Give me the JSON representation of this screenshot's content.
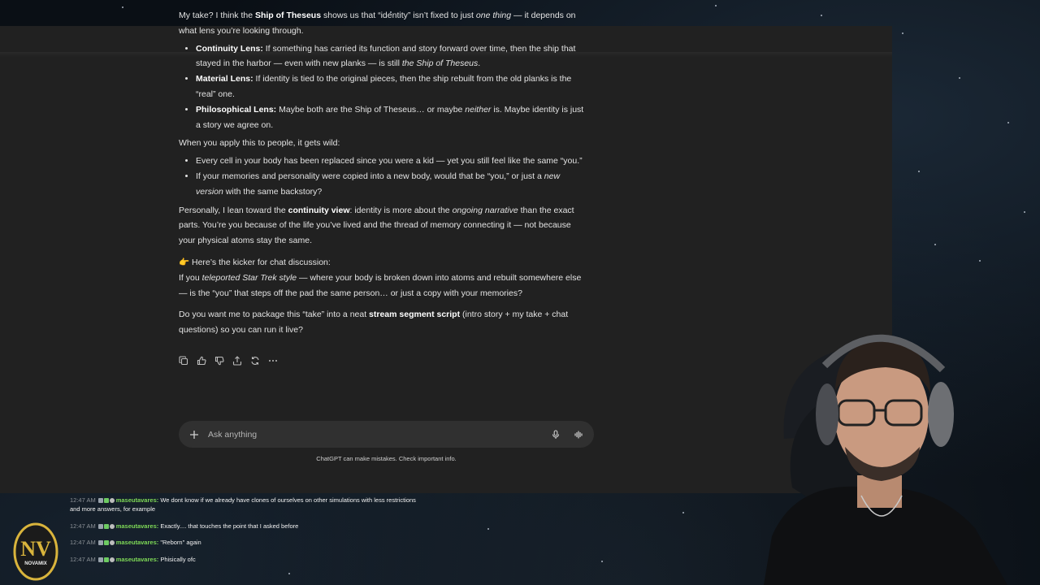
{
  "response": {
    "intro_1": "My take? I think the ",
    "intro_bold": "Ship of Theseus",
    "intro_2": " shows us that “identity” isn’t fixed to just ",
    "intro_italic": "one thing",
    "intro_3": " — it depends on what lens you’re looking through.",
    "lenses": [
      {
        "title": "Continuity Lens:",
        "text": " If something has carried its function and story forward over time, then the ship that stayed in the harbor — even with new planks — is still ",
        "italic": "the Ship of Theseus",
        "tail": "."
      },
      {
        "title": "Material Lens:",
        "text": " If identity is tied to the original pieces, then the ship rebuilt from the old planks is the “real” one.",
        "italic": "",
        "tail": ""
      },
      {
        "title": "Philosophical Lens:",
        "text": " Maybe both are the Ship of Theseus… or maybe ",
        "italic": "neither",
        "tail": " is. Maybe identity is just a story we agree on."
      }
    ],
    "people_intro": "When you apply this to people, it gets wild:",
    "people_1": "Every cell in your body has been replaced since you were a kid — yet you still feel like the same “you.”",
    "people_2a": "If your memories and personality were copied into a new body, would that be “you,” or just a ",
    "people_2_italic": "new version",
    "people_2b": " with the same backstory?",
    "personal_1": "Personally, I lean toward the ",
    "personal_bold": "continuity view",
    "personal_2": ": identity is more about the ",
    "personal_italic": "ongoing narrative",
    "personal_3": " than the exact parts. You’re you because of the life you’ve lived and the thread of memory connecting it — not because your physical atoms stay the same.",
    "kicker_emoji": "👉",
    "kicker": " Here’s the kicker for chat discussion:",
    "kicker_q1": "If you ",
    "kicker_italic": "teleported Star Trek style",
    "kicker_q2": " — where your body is broken down into atoms and rebuilt somewhere else — is the “you” that steps off the pad the same person… or just a copy with your memories?",
    "offer_1": "Do you want me to package this “take” into a neat ",
    "offer_bold": "stream segment script",
    "offer_2": " (intro story + my take + chat questions) so you can run it live?"
  },
  "actions": [
    "copy-icon",
    "thumbs-up-icon",
    "thumbs-down-icon",
    "share-icon",
    "regenerate-icon",
    "more-icon"
  ],
  "composer": {
    "placeholder": "Ask anything"
  },
  "disclaimer": "ChatGPT can make mistakes. Check important info.",
  "stream_chat": [
    {
      "time": "12:47 AM",
      "user": "maseutavares:",
      "text": "We dont know if we already have clones of ourselves on other simulations with less restrictions and more answers, for example"
    },
    {
      "time": "12:47 AM",
      "user": "maseutavares:",
      "text": "Exactly.... that touches the point that I asked before"
    },
    {
      "time": "12:47 AM",
      "user": "maseutavares:",
      "text": "\"Reborn\" again"
    },
    {
      "time": "12:47 AM",
      "user": "maseutavares:",
      "text": "Phisically ofc"
    }
  ],
  "logo": {
    "letters": "NV",
    "text": "NOVAMIX"
  },
  "colors": {
    "chat_bg": "#212121",
    "composer_bg": "#303030",
    "username": "#7ed957",
    "logo_gold": "#d9b43c"
  }
}
